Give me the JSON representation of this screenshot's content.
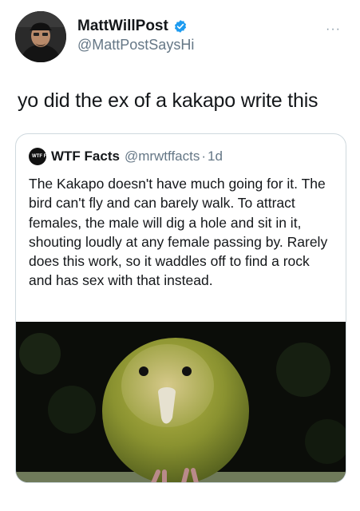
{
  "author": {
    "display_name": "MattWillPost",
    "handle": "@MattPostSaysHi",
    "verified": true,
    "avatar_icon": "profile-photo",
    "more_icon": "more-dots-icon",
    "more_glyph": "···"
  },
  "tweet": {
    "text": "yo did the ex of a kakapo write this"
  },
  "quoted_tweet": {
    "avatar_label": "WTF FACTS",
    "display_name": "WTF Facts",
    "handle": "@mrwtffacts",
    "separator": "·",
    "time": "1d",
    "text": "The Kakapo doesn't have much going for it. The bird can't fly and can barely walk. To attract females, the male will dig a hole and sit in it, shouting loudly at any female passing by. Rarely does this work, so it waddles off to find a rock and has sex with that instead.",
    "image_icon": "kakapo-photo"
  },
  "colors": {
    "verified_blue": "#1d9bf0",
    "secondary_text": "#657786",
    "border": "#cfd9de"
  }
}
